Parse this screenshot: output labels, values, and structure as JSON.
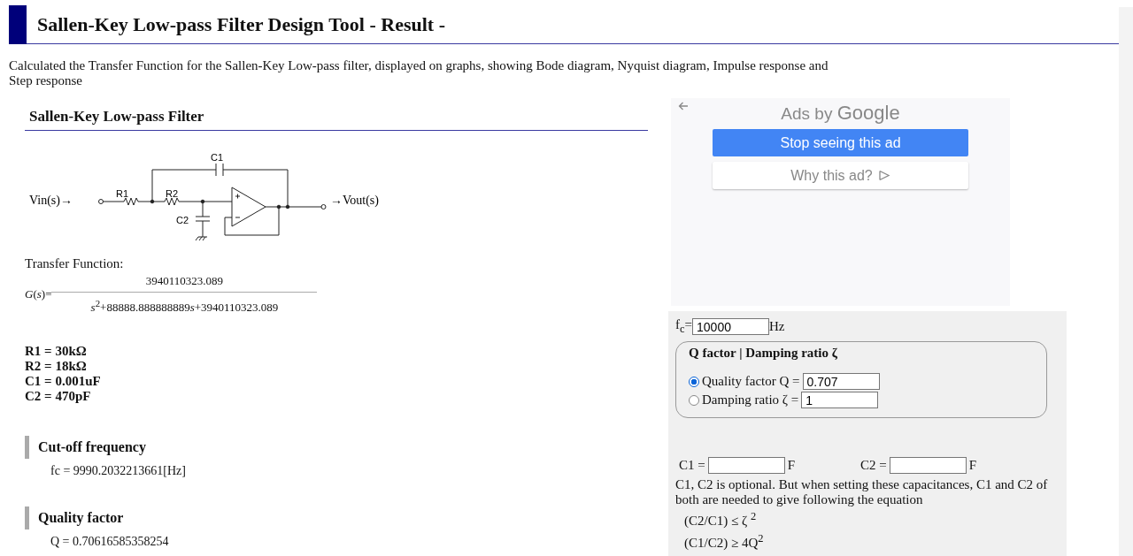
{
  "header": {
    "title": "Sallen-Key Low-pass Filter Design Tool - Result -"
  },
  "intro": "Calculated the Transfer Function for the Sallen-Key Low-pass filter, displayed on graphs, showing Bode diagram, Nyquist diagram, Impulse response and Step response",
  "circuit": {
    "title": "Sallen-Key Low-pass Filter",
    "input": "Vin(s)→",
    "output": "→Vout(s)",
    "c1": "C1",
    "r1": "R1",
    "r2": "R2",
    "c2": "C2"
  },
  "transfer_function": {
    "label": "Transfer Function:",
    "lhs": "*G*(*s*)=",
    "numerator": "3940110323.089",
    "denominator": [
      {
        "kind": "var",
        "text": "s"
      },
      {
        "kind": "sup",
        "text": "2"
      },
      {
        "kind": "plain",
        "text": "+88888.888888889"
      },
      {
        "kind": "var",
        "text": "s"
      },
      {
        "kind": "plain",
        "text": "+3940110323.089"
      }
    ]
  },
  "components": [
    "R1 = 30kΩ",
    "R2 = 18kΩ",
    "C1 = 0.001uF",
    "C2 = 470pF"
  ],
  "results": [
    {
      "heading": "Cut-off frequency",
      "value": "fc = 9990.2032213661[Hz]"
    },
    {
      "heading": "Quality factor",
      "value": "Q = 0.70616585358254"
    }
  ],
  "ad": {
    "brand_prefix": "Ads by",
    "brand": "Google",
    "buttons": [
      {
        "label": "Stop seeing this ad",
        "kind": "primary"
      },
      {
        "label": "Why this ad?",
        "kind": "secondary"
      }
    ]
  },
  "form": {
    "fc_label": "f$_{c}$=",
    "fc_value": "10000",
    "fc_unit": "Hz",
    "group_title": "Q factor | Damping ratio ζ",
    "options": [
      {
        "label": "Quality factor Q =",
        "value": "0.707",
        "selected": true
      },
      {
        "label": "Damping ratio ζ =",
        "value": "1",
        "selected": false
      }
    ],
    "capacitors": [
      {
        "label": "C1 =",
        "unit": "F"
      },
      {
        "label": "C2 =",
        "unit": "F"
      }
    ],
    "note": "C1, C2 is optional. But when setting these capacitances, C1 and C2 of both are needed to give following the equation",
    "equations": [
      "(C2/C1) ≤ ζ $^{2}$",
      "(C1/C2) ≥ 4Q$^{2}$"
    ]
  }
}
